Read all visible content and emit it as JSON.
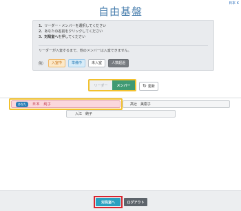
{
  "corner_link": "日本 K",
  "title": "自由基盤",
  "instructions": {
    "steps": [
      {
        "num": "1.",
        "text": "リーダー・メンバーを選択してください"
      },
      {
        "num": "2.",
        "text": "あなたの名前をクリックしてください"
      },
      {
        "num": "3.",
        "bold": "対局室へ",
        "text": "を押してください"
      }
    ],
    "note": "リーダーが入室するまで、他のメンバーは入室できません。",
    "legend_prefix": "例）",
    "legend": [
      {
        "label": "入室中",
        "status": "in-room"
      },
      {
        "label": "準備中",
        "status": "preparing"
      },
      {
        "label": "未入室",
        "status": "not-in"
      },
      {
        "label": "人数超過",
        "status": "over"
      }
    ]
  },
  "role_toggle": {
    "leader_label": "リーダー",
    "member_label": "メンバー",
    "selected": "member"
  },
  "refresh_label": "更新",
  "members": [
    {
      "tag": "あなた",
      "name": "日本　純子",
      "selected": true
    },
    {
      "name": "高辻　美樹子",
      "selected": false
    },
    {
      "name": "入江　純子",
      "selected": false
    }
  ],
  "footer": {
    "enter_label": "対局室へ",
    "logout_label": "ログアウト"
  }
}
